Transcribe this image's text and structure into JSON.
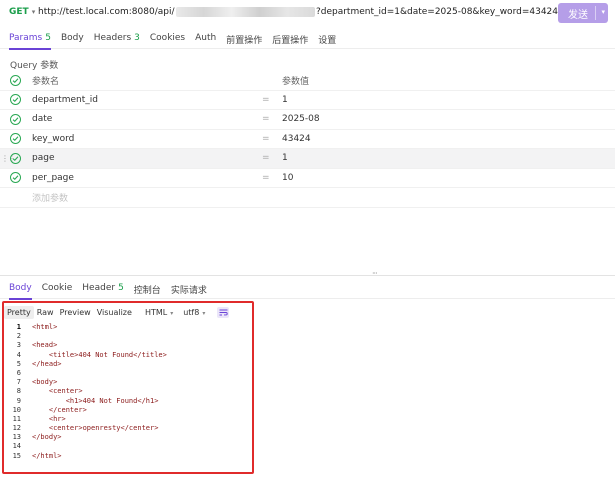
{
  "request": {
    "method": "GET",
    "url_start": "http://test.local.com:8080/api/",
    "url_end": "?department_id=1&date=2025-08&key_word=43424",
    "send_label": "发送"
  },
  "request_tabs": [
    {
      "label": "Params",
      "count": "5",
      "active": true
    },
    {
      "label": "Body",
      "count": ""
    },
    {
      "label": "Headers",
      "count": "3"
    },
    {
      "label": "Cookies",
      "count": ""
    },
    {
      "label": "Auth",
      "count": ""
    },
    {
      "label": "前置操作",
      "count": ""
    },
    {
      "label": "后置操作",
      "count": ""
    },
    {
      "label": "设置",
      "count": ""
    }
  ],
  "query": {
    "section_label": "Query 参数",
    "col_name": "参数名",
    "col_value": "参数值",
    "params": [
      {
        "name": "department_id",
        "value": "1"
      },
      {
        "name": "date",
        "value": "2025-08"
      },
      {
        "name": "key_word",
        "value": "43424"
      },
      {
        "name": "page",
        "value": "1"
      },
      {
        "name": "per_page",
        "value": "10"
      }
    ],
    "add_placeholder": "添加参数",
    "eq": "="
  },
  "response_tabs": [
    {
      "label": "Body",
      "count": "",
      "active": true
    },
    {
      "label": "Cookie",
      "count": ""
    },
    {
      "label": "Header",
      "count": "5"
    },
    {
      "label": "控制台",
      "count": ""
    },
    {
      "label": "实际请求",
      "count": ""
    }
  ],
  "view": {
    "modes": [
      "Pretty",
      "Raw",
      "Preview",
      "Visualize"
    ],
    "format": "HTML",
    "encoding": "utf8"
  },
  "code_lines": [
    "<html>",
    "",
    "<head>",
    "    <title>404 Not Found</title>",
    "</head>",
    "",
    "<body>",
    "    <center>",
    "        <h1>404 Not Found</h1>",
    "    </center>",
    "    <hr>",
    "    <center>openresty</center>",
    "</body>",
    "",
    "</html>"
  ],
  "colors": {
    "accent": "#6a43d6",
    "send_bg": "#b59ee8",
    "method": "#1b9e4b",
    "highlight_border": "#e02b2b"
  },
  "icons": {
    "check": "check-circle-icon",
    "wrap": "wrap-lines-icon"
  }
}
